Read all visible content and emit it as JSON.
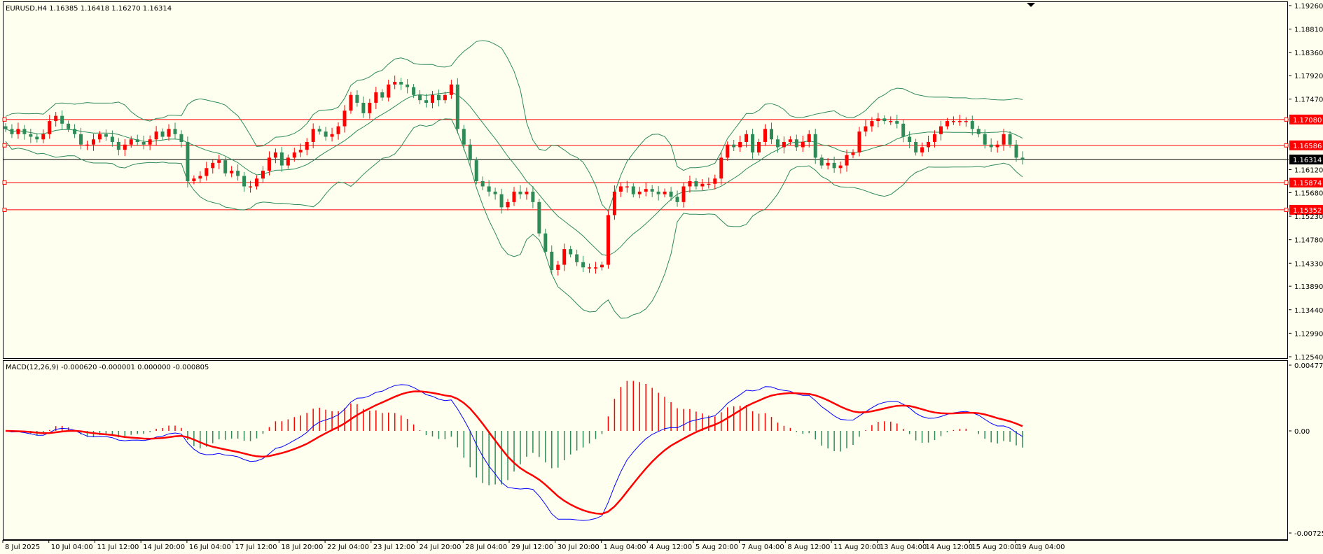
{
  "colors": {
    "background": "#fffff0",
    "frame": "#000000",
    "bull": "#ff0000",
    "bear": "#2e8b57",
    "bands": "#2e8b57",
    "level_line": "#ff0000",
    "current_line": "#000000",
    "macd_main": "#0000ff",
    "macd_signal": "#ff0000",
    "hist_pos": "#ff0000",
    "hist_neg": "#2e8b57"
  },
  "header": {
    "main": "EURUSD,H4  1.16385 1.16418 1.16270 1.16314",
    "macd": "MACD(12,26,9) -0.000620 -0.000001 0.000000 -0.000805"
  },
  "chart_data": [
    {
      "type": "candlestick",
      "symbol": "EURUSD",
      "timeframe": "H4",
      "ylim": [
        1.1254,
        1.1926
      ],
      "y_ticks": [
        "1.19260",
        "1.18810",
        "1.18360",
        "1.17920",
        "1.17470",
        "1.16120",
        "1.15680",
        "1.15230",
        "1.14780",
        "1.14330",
        "1.13890",
        "1.13440",
        "1.12990",
        "1.12540"
      ],
      "x_ticks": [
        "8 Jul 2025",
        "10 Jul 04:00",
        "11 Jul 12:00",
        "14 Jul 20:00",
        "16 Jul 04:00",
        "17 Jul 12:00",
        "18 Jul 20:00",
        "22 Jul 04:00",
        "23 Jul 12:00",
        "24 Jul 20:00",
        "28 Jul 04:00",
        "29 Jul 12:00",
        "30 Jul 20:00",
        "1 Aug 04:00",
        "4 Aug 12:00",
        "5 Aug 20:00",
        "7 Aug 04:00",
        "8 Aug 12:00",
        "11 Aug 20:00",
        "13 Aug 04:00",
        "14 Aug 12:00",
        "15 Aug 20:00",
        "19 Aug 04:00"
      ],
      "last_price": "1.16314",
      "levels": [
        "1.17080",
        "1.16586",
        "1.15874",
        "1.15352"
      ],
      "close_path": [
        1.169,
        1.168,
        1.169,
        1.168,
        1.1675,
        1.167,
        1.168,
        1.1705,
        1.1715,
        1.17,
        1.169,
        1.168,
        1.166,
        1.166,
        1.167,
        1.168,
        1.1675,
        1.1665,
        1.165,
        1.166,
        1.167,
        1.1665,
        1.166,
        1.167,
        1.1685,
        1.1675,
        1.169,
        1.168,
        1.1665,
        1.159,
        1.1595,
        1.16,
        1.1615,
        1.1625,
        1.163,
        1.1605,
        1.161,
        1.16,
        1.158,
        1.158,
        1.1595,
        1.161,
        1.1635,
        1.1645,
        1.162,
        1.1635,
        1.1645,
        1.165,
        1.1665,
        1.169,
        1.1685,
        1.1675,
        1.168,
        1.1695,
        1.1725,
        1.1755,
        1.174,
        1.172,
        1.174,
        1.176,
        1.175,
        1.1775,
        1.178,
        1.1775,
        1.177,
        1.1755,
        1.1745,
        1.174,
        1.1755,
        1.1745,
        1.1755,
        1.1775,
        1.169,
        1.166,
        1.163,
        1.159,
        1.158,
        1.157,
        1.1565,
        1.154,
        1.155,
        1.157,
        1.1565,
        1.157,
        1.155,
        1.149,
        1.1455,
        1.142,
        1.143,
        1.146,
        1.145,
        1.1435,
        1.1425,
        1.1425,
        1.1425,
        1.143,
        1.1525,
        1.157,
        1.158,
        1.158,
        1.1565,
        1.157,
        1.1575,
        1.157,
        1.1565,
        1.157,
        1.156,
        1.155,
        1.158,
        1.159,
        1.158,
        1.1585,
        1.1585,
        1.1595,
        1.1635,
        1.166,
        1.1655,
        1.1665,
        1.168,
        1.1645,
        1.1665,
        1.169,
        1.167,
        1.1655,
        1.1665,
        1.167,
        1.1655,
        1.1665,
        1.168,
        1.1635,
        1.162,
        1.1625,
        1.1615,
        1.162,
        1.164,
        1.1645,
        1.1685,
        1.1695,
        1.1705,
        1.171,
        1.1705,
        1.1705,
        1.17,
        1.1675,
        1.1665,
        1.1645,
        1.1655,
        1.1665,
        1.168,
        1.1695,
        1.1705,
        1.1705,
        1.1705,
        1.1705,
        1.169,
        1.168,
        1.166,
        1.1655,
        1.166,
        1.168,
        1.166,
        1.1635,
        1.1631
      ],
      "macd": {
        "range": [
          -0.007257,
          0.004774
        ],
        "y_ticks": [
          "0.004774",
          "0.00",
          "-0.007257"
        ]
      }
    }
  ]
}
